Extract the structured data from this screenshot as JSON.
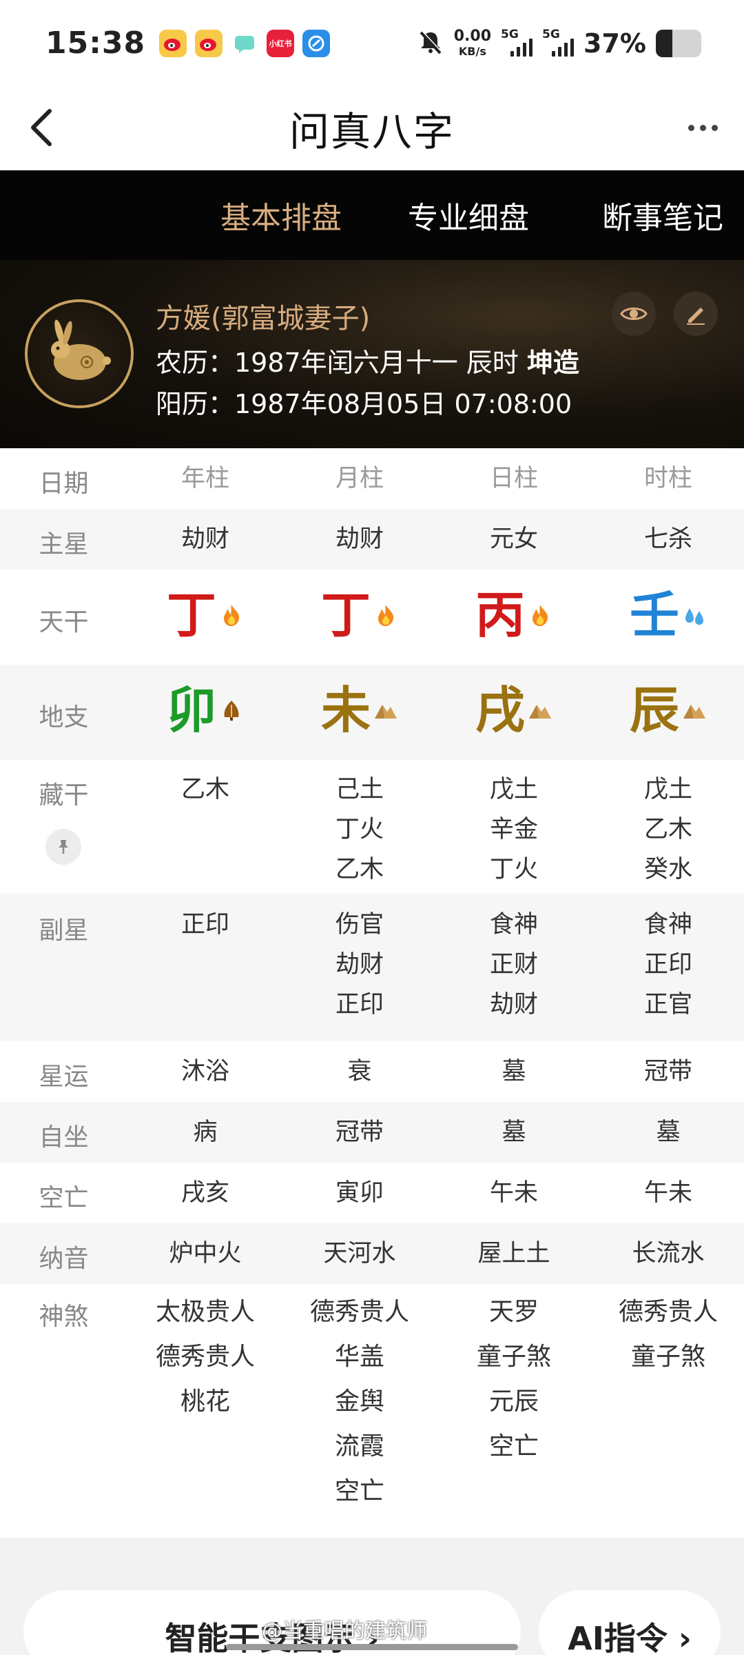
{
  "status": {
    "time": "15:38",
    "speed_value": "0.00",
    "speed_unit": "KB/s",
    "signal1_label": "5G",
    "signal2_label": "5G",
    "battery_text": "37%",
    "battery_level": 0.37,
    "notification_icons": [
      "weibo-icon",
      "weibo-icon",
      "chat-icon",
      "xiaohongshu-icon",
      "browser-icon"
    ],
    "xiaohongshu_text": "小红书"
  },
  "header": {
    "title": "问真八字"
  },
  "tabs": [
    {
      "label": "基本排盘",
      "active": true
    },
    {
      "label": "专业细盘",
      "active": false
    },
    {
      "label": "断事笔记",
      "active": false
    }
  ],
  "profile": {
    "name": "方媛(郭富城妻子)",
    "lunar_prefix": "农历：1987年闰六月十一 辰时 ",
    "lunar_gender": "坤造",
    "solar": "阳历：1987年08月05日 07:08:00"
  },
  "table": {
    "header": {
      "label": "日期",
      "cols": [
        "年柱",
        "月柱",
        "日柱",
        "时柱"
      ]
    },
    "main_star": {
      "label": "主星",
      "cols": [
        "劫财",
        "劫财",
        "元女",
        "七杀"
      ]
    },
    "heavenly_stems": {
      "label": "天干",
      "cols": [
        {
          "char": "丁",
          "color": "#d11a1a",
          "element_icon": "fire-icon"
        },
        {
          "char": "丁",
          "color": "#d11a1a",
          "element_icon": "fire-icon"
        },
        {
          "char": "丙",
          "color": "#d11a1a",
          "element_icon": "fire-icon"
        },
        {
          "char": "壬",
          "color": "#1f83d6",
          "element_icon": "water-icon"
        }
      ]
    },
    "earthly_branches": {
      "label": "地支",
      "cols": [
        {
          "char": "卯",
          "color": "#1c9a2a",
          "element_icon": "wood-icon"
        },
        {
          "char": "未",
          "color": "#9a7210",
          "element_icon": "earth-icon"
        },
        {
          "char": "戌",
          "color": "#9a7210",
          "element_icon": "earth-icon"
        },
        {
          "char": "辰",
          "color": "#9a7210",
          "element_icon": "earth-icon"
        }
      ]
    },
    "hidden_stems": {
      "label": "藏干",
      "cols": [
        [
          {
            "t": "乙木",
            "c": "green"
          }
        ],
        [
          {
            "t": "己土",
            "c": "brown"
          },
          {
            "t": "丁火",
            "c": "red"
          },
          {
            "t": "乙木",
            "c": "green"
          }
        ],
        [
          {
            "t": "戊土",
            "c": "brown"
          },
          {
            "t": "辛金",
            "c": "orange"
          },
          {
            "t": "丁火",
            "c": "red"
          }
        ],
        [
          {
            "t": "戊土",
            "c": "brown"
          },
          {
            "t": "乙木",
            "c": "green"
          },
          {
            "t": "癸水",
            "c": "blue"
          }
        ]
      ]
    },
    "sub_star": {
      "label": "副星",
      "cols": [
        [
          "正印"
        ],
        [
          "伤官",
          "劫财",
          "正印"
        ],
        [
          "食神",
          "正财",
          "劫财"
        ],
        [
          "食神",
          "正印",
          "正官"
        ]
      ]
    },
    "star_luck": {
      "label": "星运",
      "cols": [
        "沐浴",
        "衰",
        "墓",
        "冠带"
      ]
    },
    "self_seat": {
      "label": "自坐",
      "cols": [
        "病",
        "冠带",
        "墓",
        "墓"
      ]
    },
    "void": {
      "label": "空亡",
      "cols": [
        "戌亥",
        "寅卯",
        "午未",
        "午未"
      ]
    },
    "nayin": {
      "label": "纳音",
      "cols": [
        "炉中火",
        "天河水",
        "屋上土",
        "长流水"
      ]
    },
    "shensha": {
      "label": "神煞",
      "cols": [
        [
          "太极贵人",
          "德秀贵人",
          "桃花"
        ],
        [
          "德秀贵人",
          "华盖",
          "金舆",
          "流霞",
          "空亡"
        ],
        [
          "天罗",
          "童子煞",
          "元辰",
          "空亡"
        ],
        [
          "德秀贵人",
          "童子煞"
        ]
      ]
    }
  },
  "footer": {
    "left_button": "智能干支图示 ›",
    "right_button": "AI指令 ›",
    "watermark": "@当重唱的建筑师"
  },
  "colors": {
    "accent_gold": "#d8ad80",
    "shensha_gold": "#b49063",
    "fire_red": "#d11a1a",
    "wood_green": "#1c9a2a",
    "earth_brown": "#9a7210",
    "water_blue": "#1f83d6",
    "metal_orange": "#e88f0c"
  }
}
